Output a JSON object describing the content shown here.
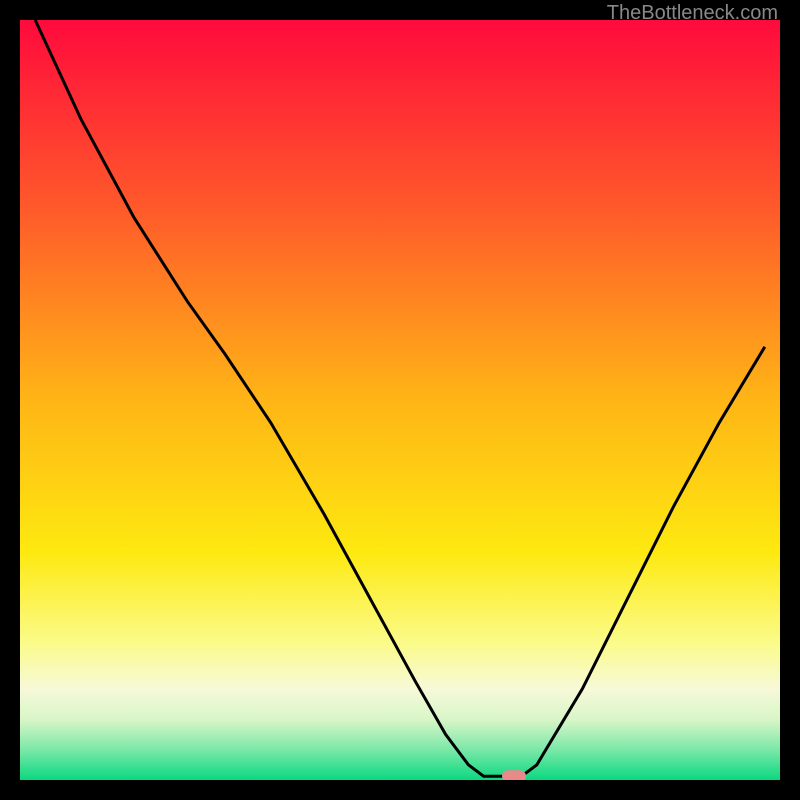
{
  "watermark": "TheBottleneck.com",
  "chart_data": {
    "type": "line",
    "title": "",
    "xlabel": "",
    "ylabel": "",
    "xlim": [
      0,
      100
    ],
    "ylim": [
      0,
      100
    ],
    "gradient_stops": [
      {
        "offset": 0,
        "color": "#ff0a3c"
      },
      {
        "offset": 0.25,
        "color": "#ff5a2a"
      },
      {
        "offset": 0.5,
        "color": "#ffb516"
      },
      {
        "offset": 0.7,
        "color": "#fde910"
      },
      {
        "offset": 0.82,
        "color": "#fbfb8a"
      },
      {
        "offset": 0.88,
        "color": "#f7f9d8"
      },
      {
        "offset": 0.92,
        "color": "#d9f6c8"
      },
      {
        "offset": 0.96,
        "color": "#7be8a8"
      },
      {
        "offset": 1.0,
        "color": "#0bd880"
      }
    ],
    "curve": [
      {
        "x": 2,
        "y": 100
      },
      {
        "x": 8,
        "y": 87
      },
      {
        "x": 15,
        "y": 74
      },
      {
        "x": 22,
        "y": 63
      },
      {
        "x": 27,
        "y": 56
      },
      {
        "x": 33,
        "y": 47
      },
      {
        "x": 40,
        "y": 35
      },
      {
        "x": 46,
        "y": 24
      },
      {
        "x": 52,
        "y": 13
      },
      {
        "x": 56,
        "y": 6
      },
      {
        "x": 59,
        "y": 2
      },
      {
        "x": 61,
        "y": 0.5
      },
      {
        "x": 64,
        "y": 0.5
      },
      {
        "x": 66,
        "y": 0.5
      },
      {
        "x": 68,
        "y": 2
      },
      {
        "x": 74,
        "y": 12
      },
      {
        "x": 80,
        "y": 24
      },
      {
        "x": 86,
        "y": 36
      },
      {
        "x": 92,
        "y": 47
      },
      {
        "x": 98,
        "y": 57
      }
    ],
    "marker": {
      "x": 65,
      "y": 0.5,
      "color": "#e88a8a"
    }
  }
}
